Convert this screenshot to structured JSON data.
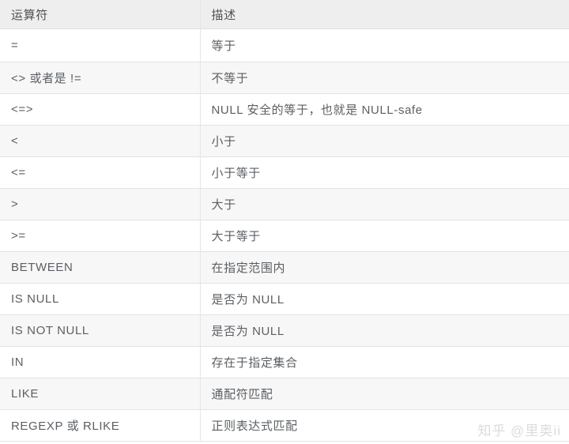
{
  "page": {
    "kind": "reference-table",
    "watermark": "知乎 @里奥ii",
    "colors": {
      "header_bg": "#eeeeee",
      "stripe_bg": "#f7f7f7",
      "row_bg": "#ffffff",
      "border": "#e3e3e3",
      "text": "#5b5f63",
      "watermark_text": "#d9dcdf"
    }
  },
  "table": {
    "columns": [
      {
        "key": "operator",
        "label": "运算符"
      },
      {
        "key": "description",
        "label": "描述"
      }
    ],
    "rows": [
      {
        "operator": "=",
        "description": "等于"
      },
      {
        "operator": "<> 或者是 !=",
        "description": "不等于"
      },
      {
        "operator": "<=>",
        "description": "NULL 安全的等于，也就是 NULL-safe"
      },
      {
        "operator": "<",
        "description": "小于"
      },
      {
        "operator": "<=",
        "description": "小于等于"
      },
      {
        "operator": ">",
        "description": "大于"
      },
      {
        "operator": ">=",
        "description": "大于等于"
      },
      {
        "operator": "BETWEEN",
        "description": "在指定范围内"
      },
      {
        "operator": "IS NULL",
        "description": "是否为 NULL"
      },
      {
        "operator": "IS NOT NULL",
        "description": "是否为 NULL"
      },
      {
        "operator": "IN",
        "description": "存在于指定集合"
      },
      {
        "operator": "LIKE",
        "description": "通配符匹配"
      },
      {
        "operator": "REGEXP 或 RLIKE",
        "description": "正则表达式匹配"
      }
    ]
  }
}
